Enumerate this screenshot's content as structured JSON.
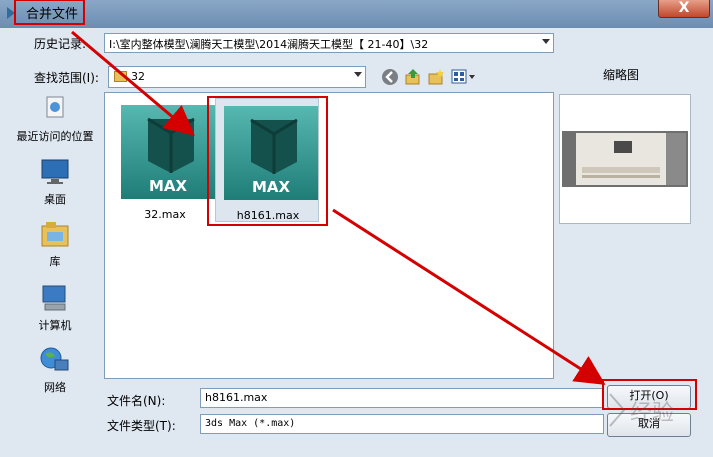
{
  "window": {
    "title": "合并文件",
    "close_label": "X"
  },
  "history": {
    "label": "历史记录:",
    "value": "I:\\室内整体模型\\澜腾天工模型\\2014澜腾天工模型【 21-40】\\32"
  },
  "lookin": {
    "label": "查找范围(I):",
    "value": "32"
  },
  "thumbnail": {
    "label": "缩略图"
  },
  "places": [
    {
      "label": "最近访问的位置",
      "icon": "recent-places-icon"
    },
    {
      "label": "桌面",
      "icon": "desktop-icon"
    },
    {
      "label": "库",
      "icon": "libraries-icon"
    },
    {
      "label": "计算机",
      "icon": "computer-icon"
    },
    {
      "label": "网络",
      "icon": "network-icon"
    }
  ],
  "files": [
    {
      "name": "32.max",
      "badge": "MAX"
    },
    {
      "name": "h8161.max",
      "badge": "MAX"
    }
  ],
  "filename": {
    "label": "文件名(N):",
    "value": "h8161.max"
  },
  "filetype": {
    "label": "文件类型(T):",
    "value": "3ds Max (*.max)"
  },
  "buttons": {
    "open": "打开(O)",
    "cancel": "取消"
  },
  "watermark": {
    "text": "经验"
  },
  "colors": {
    "annotation": "#d40000",
    "max_teal": "#2c8c86",
    "titlebar": "#7896ba"
  }
}
